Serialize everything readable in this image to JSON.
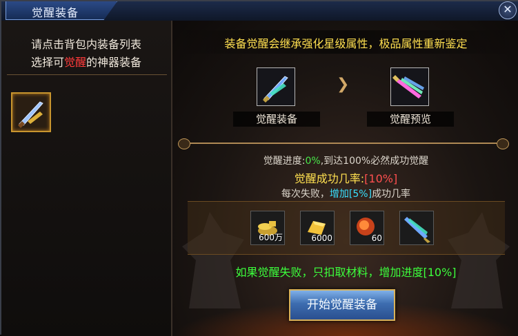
{
  "window": {
    "title": "觉醒装备",
    "close_glyph": "✕"
  },
  "left_panel": {
    "hint_line1": "请点击背包内装备列表",
    "hint_line2_pre": "选择可",
    "hint_line2_red": "觉醒",
    "hint_line2_post": "的神器装备",
    "equipment_slot_icon": "sword-icon"
  },
  "main": {
    "subtitle": "装备觉醒会继承强化星级属性，极品属性重新鉴定",
    "awaken_slot": {
      "label": "觉醒装备",
      "icon": "sword-icon"
    },
    "preview_slot": {
      "label": "觉醒预览",
      "icon": "glowing-sword-icon"
    },
    "arrow_icon": "chevron-right-icon",
    "progress": {
      "prefix": "觉醒进度:",
      "value": "0%",
      "suffix": ",到达100%必然成功觉醒"
    },
    "success_rate": {
      "label": "觉醒成功几率:",
      "value": "[10%]"
    },
    "fail_note": {
      "pre": "每次失败，",
      "highlight": "增加[5%]",
      "post": "成功几率"
    },
    "materials": [
      {
        "name": "gold-coins-icon",
        "qty": "600万"
      },
      {
        "name": "gold-ingot-icon",
        "qty": "6000"
      },
      {
        "name": "fire-orb-icon",
        "qty": "60"
      },
      {
        "name": "sword-icon",
        "qty": ""
      }
    ],
    "failure_notice": "如果觉醒失败，只扣取材料，增加进度[10%]",
    "start_button": "开始觉醒装备"
  },
  "colors": {
    "accent_gold": "#ffe050",
    "green": "#3cff3c",
    "red": "#ff4f4f",
    "cyan": "#39e0ff"
  }
}
